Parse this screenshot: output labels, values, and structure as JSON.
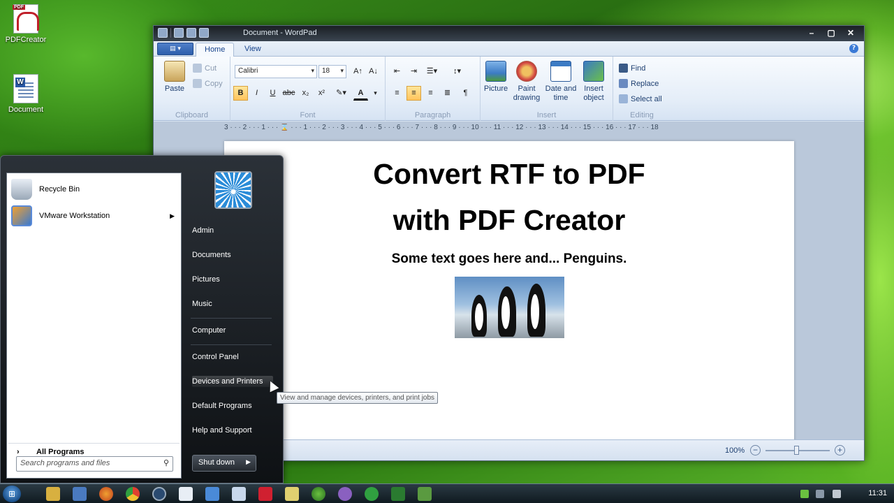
{
  "desktop": {
    "icons": [
      {
        "label": "PDFCreator",
        "icon": "pdfcreator-icon"
      },
      {
        "label": "Document",
        "icon": "document-icon"
      }
    ]
  },
  "wordpad": {
    "title": "Document - WordPad",
    "tabs": [
      "Home",
      "View"
    ],
    "clipboard": {
      "paste": "Paste",
      "cut": "Cut",
      "copy": "Copy",
      "label": "Clipboard"
    },
    "font": {
      "family": "Calibri",
      "size": "18",
      "label": "Font"
    },
    "paragraph": {
      "label": "Paragraph"
    },
    "insert": {
      "picture": "Picture",
      "paint_drawing": [
        "Paint",
        "drawing"
      ],
      "date_time": [
        "Date and",
        "time"
      ],
      "insert_object": [
        "Insert",
        "object"
      ],
      "label": "Insert"
    },
    "editing": {
      "find": "Find",
      "replace": "Replace",
      "select_all": "Select all",
      "label": "Editing"
    },
    "ruler": "3 · · · 2 · · · 1 · · · ⌛ · · · 1 · · · 2 · · · 3 · · · 4 · · · 5 · · · 6 · · · 7 · · · 8 · · · 9 · · · 10 · · · 11 · · · 12 · · · 13 · · · 14 · · · 15 · · · 16 · · · 17 · · · 18",
    "document": {
      "heading_line1": "Convert RTF to PDF",
      "heading_line2": "with PDF Creator",
      "subheading": "Some text goes here and... Penguins."
    },
    "status": {
      "zoom": "100%",
      "zoom_level_percent": 100
    }
  },
  "start_menu": {
    "pinned": [
      {
        "label": "Recycle Bin",
        "icon": "recycle-bin-icon"
      },
      {
        "label": "VMware Workstation",
        "icon": "vmware-icon"
      }
    ],
    "all_programs": "All Programs",
    "search_placeholder": "Search programs and files",
    "right_items": [
      "Admin",
      "Documents",
      "Pictures",
      "Music",
      "Computer",
      "Control Panel",
      "Devices and Printers",
      "Default Programs",
      "Help and Support"
    ],
    "shutdown": "Shut down",
    "tooltip": "View and manage devices, printers, and print jobs"
  },
  "taskbar": {
    "clock": "11:31"
  }
}
